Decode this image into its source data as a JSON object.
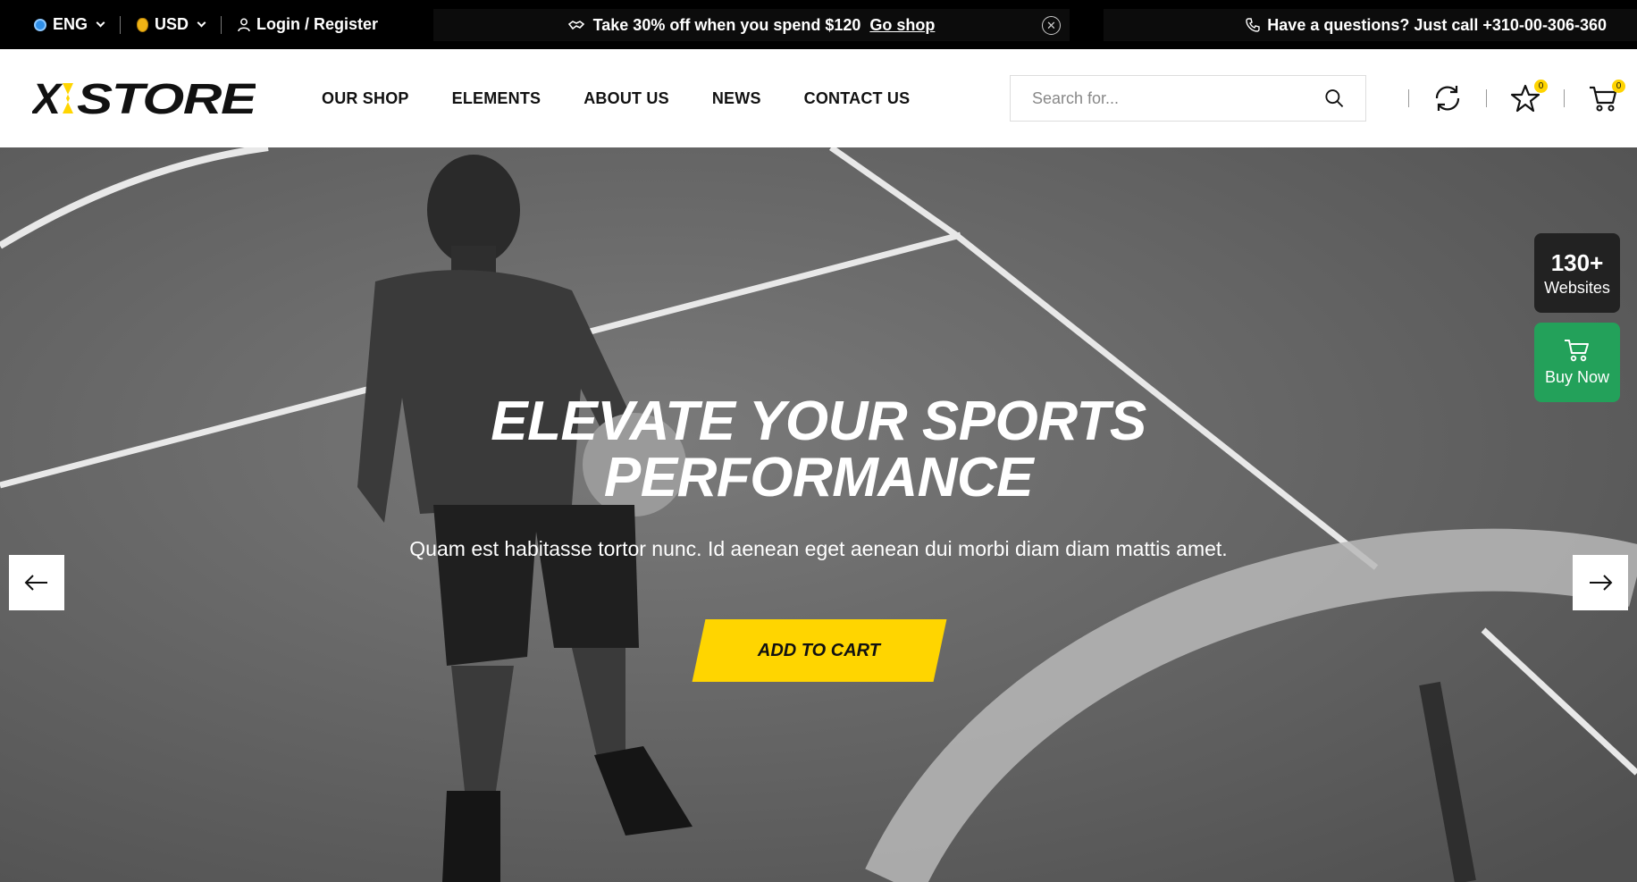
{
  "topbar": {
    "language": "ENG",
    "currency": "USD",
    "login": "Login / Register",
    "promo_text": "Take 30% off when you spend $120",
    "promo_link": "Go shop",
    "phone_text": "Have a questions? Just call +310-00-306-360"
  },
  "header": {
    "logo": "XSTORE",
    "nav": [
      "OUR SHOP",
      "ELEMENTS",
      "ABOUT US",
      "NEWS",
      "CONTACT US"
    ],
    "search_placeholder": "Search for...",
    "wishlist_count": "0",
    "cart_count": "0"
  },
  "hero": {
    "title_line1": "ELEVATE YOUR SPORTS",
    "title_line2": "PERFORMANCE",
    "subtitle": "Quam est habitasse tortor nunc. Id aenean eget aenean dui morbi diam diam mattis amet.",
    "cta": "ADD TO CART"
  },
  "side": {
    "websites_count": "130+",
    "websites_label": "Websites",
    "buy_label": "Buy Now"
  },
  "colors": {
    "accent": "#ffd500",
    "buy_green": "#23a15a",
    "topbar": "#000000"
  }
}
